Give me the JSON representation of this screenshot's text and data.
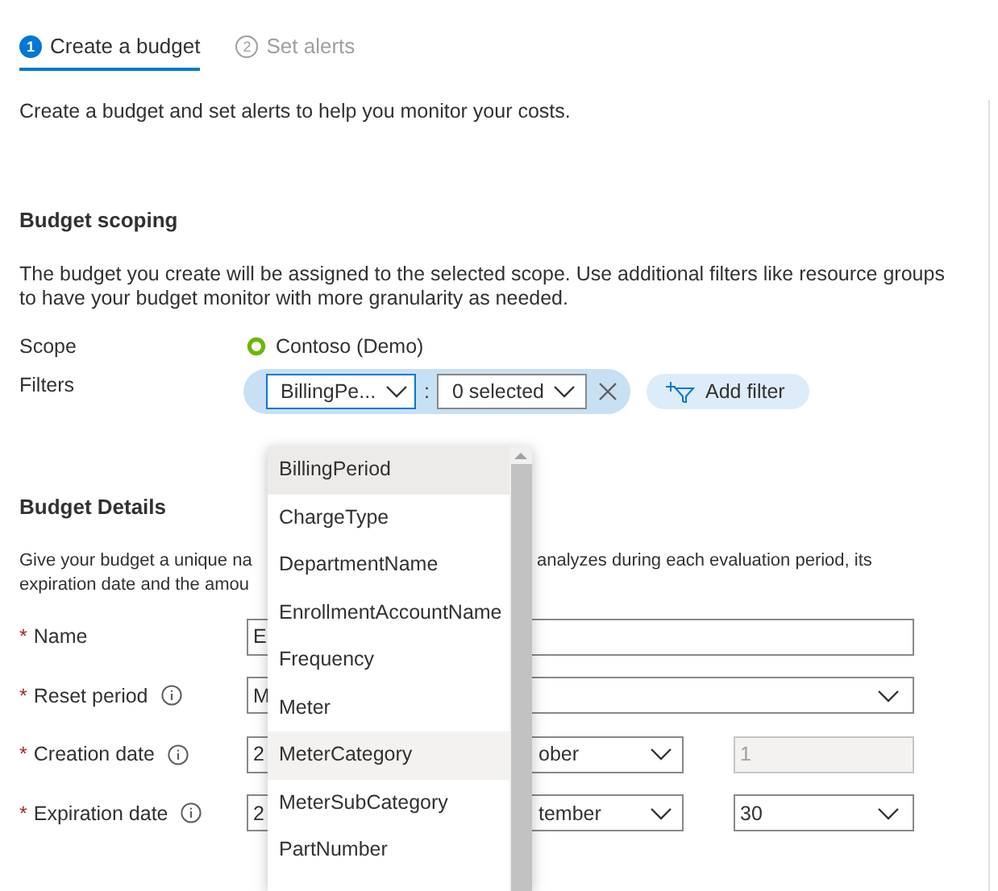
{
  "steps": [
    {
      "number": "1",
      "label": "Create a budget",
      "selected": true
    },
    {
      "number": "2",
      "label": "Set alerts",
      "selected": false
    }
  ],
  "intro": "Create a budget and set alerts to help you monitor your costs.",
  "scoping": {
    "heading": "Budget scoping",
    "description": [
      "The budget you create will be assigned to the selected scope. Use additional filters like resource groups",
      "to have your budget monitor with more granularity as needed."
    ],
    "scope_label": "Scope",
    "scope_value": "Contoso (Demo)",
    "filters_label": "Filters",
    "filter": {
      "property": "BillingPe...",
      "separator": ":",
      "values": "0 selected"
    },
    "add_filter": "Add filter"
  },
  "details": {
    "heading": "Budget Details",
    "description_left": [
      "Give your budget a unique na",
      "expiration date and the amou"
    ],
    "description_right": "analyzes during each evaluation period, its",
    "fields": [
      {
        "kind": "text",
        "label": "Name",
        "required_mark": "*",
        "info": false,
        "value": "E"
      },
      {
        "kind": "select",
        "label": "Reset period",
        "required_mark": "*",
        "info": true,
        "value": "M"
      },
      {
        "kind": "date",
        "label": "Creation date",
        "required_mark": "*",
        "info": true,
        "year": "2",
        "month": "ober",
        "day": "1",
        "day_disabled": true
      },
      {
        "kind": "date",
        "label": "Expiration date",
        "required_mark": "*",
        "info": true,
        "year": "2",
        "month": "tember",
        "day": "30",
        "day_disabled": false
      }
    ]
  },
  "dropdown": {
    "items": [
      {
        "label": "BillingPeriod",
        "selected": true,
        "hovered": false
      },
      {
        "label": "ChargeType",
        "selected": false,
        "hovered": false
      },
      {
        "label": "DepartmentName",
        "selected": false,
        "hovered": false
      },
      {
        "label": "EnrollmentAccountName",
        "selected": false,
        "hovered": false
      },
      {
        "label": "Frequency",
        "selected": false,
        "hovered": false
      },
      {
        "label": "Meter",
        "selected": false,
        "hovered": false
      },
      {
        "label": "MeterCategory",
        "selected": false,
        "hovered": true
      },
      {
        "label": "MeterSubCategory",
        "selected": false,
        "hovered": false
      },
      {
        "label": "PartNumber",
        "selected": false,
        "hovered": false
      }
    ]
  }
}
